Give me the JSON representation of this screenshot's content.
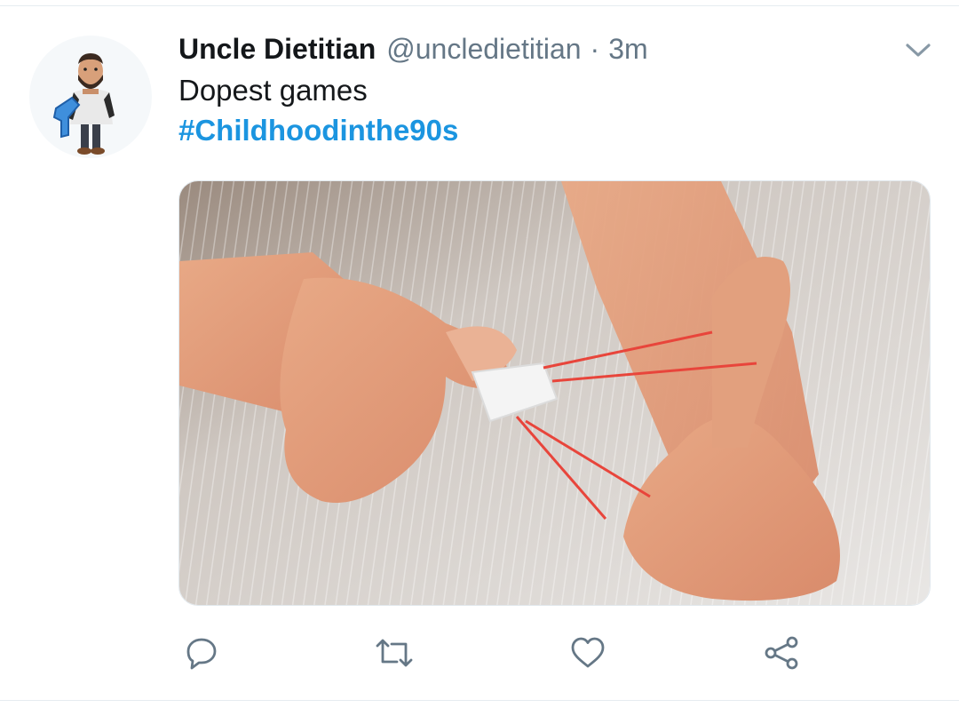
{
  "tweet": {
    "display_name": "Uncle Dietitian",
    "handle": "@uncledietitian",
    "separator": "·",
    "time": "3m",
    "text": "Dopest games",
    "hashtag": "#Childhoodinthe90s"
  },
  "icons": {
    "menu": "chevron-down-icon",
    "reply": "reply-icon",
    "retweet": "retweet-icon",
    "like": "heart-icon",
    "share": "share-icon"
  },
  "colors": {
    "name": "#14171a",
    "secondary_text": "#657786",
    "hashtag": "#1b95e0",
    "icon": "#657786",
    "divider": "#e6ecf0"
  }
}
